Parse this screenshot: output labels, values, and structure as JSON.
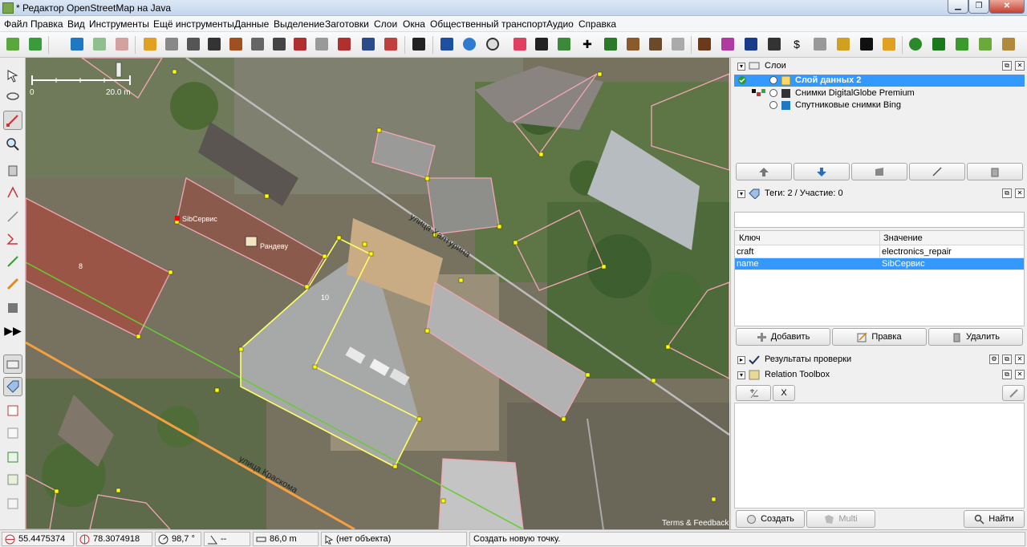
{
  "window": {
    "title": "* Редактор OpenStreetMap на Java",
    "controls": [
      "minimize",
      "maximize",
      "close"
    ]
  },
  "menu": [
    "Файл",
    "Правка",
    "Вид",
    "Инструменты",
    "Ещё инструменты",
    "Данные",
    "Выделение",
    "Заготовки",
    "Слои",
    "Окна",
    "Общественный транспорт",
    "Аудио",
    "Справка"
  ],
  "map": {
    "scale_label": "20.0 m",
    "scale_zero": "0",
    "street_labels": [
      "улица Халтурина",
      "улица Краскома"
    ],
    "building_labels": [
      "8",
      "10"
    ],
    "poi_labels": [
      "SibСервис",
      "Рандеву"
    ],
    "attribution": "Terms & Feedback"
  },
  "layers_panel": {
    "title": "Слои",
    "layers": [
      {
        "name": "Слой данных 2",
        "selected": true
      },
      {
        "name": "Снимки DigitalGlobe Premium",
        "selected": false
      },
      {
        "name": "Спутниковые снимки Bing",
        "selected": false
      }
    ]
  },
  "tags_panel": {
    "title": "Теги: 2 / Участие: 0",
    "col_key": "Ключ",
    "col_value": "Значение",
    "rows": [
      {
        "key": "craft",
        "value": "electronics_repair",
        "selected": false
      },
      {
        "key": "name",
        "value": "SibСервис",
        "selected": true
      }
    ],
    "btn_add": "Добавить",
    "btn_edit": "Правка",
    "btn_delete": "Удалить"
  },
  "validation_panel": {
    "title": "Результаты проверки"
  },
  "relation_panel": {
    "title": "Relation Toolbox",
    "btn_x": "X",
    "btn_create": "Создать",
    "btn_multi": "Multi",
    "btn_find": "Найти"
  },
  "status": {
    "lat": "55.4475374",
    "lon": "78.3074918",
    "heading": "98,7 °",
    "angle": "--",
    "distance": "86,0 m",
    "object": "(нет объекта)",
    "message": "Создать новую точку."
  },
  "colors": {
    "selection": "#3399ff",
    "building_outline": "#f0a7b4",
    "selected_way": "#ffff66",
    "road_orange": "#f5a040",
    "road_green": "#66cc33"
  }
}
